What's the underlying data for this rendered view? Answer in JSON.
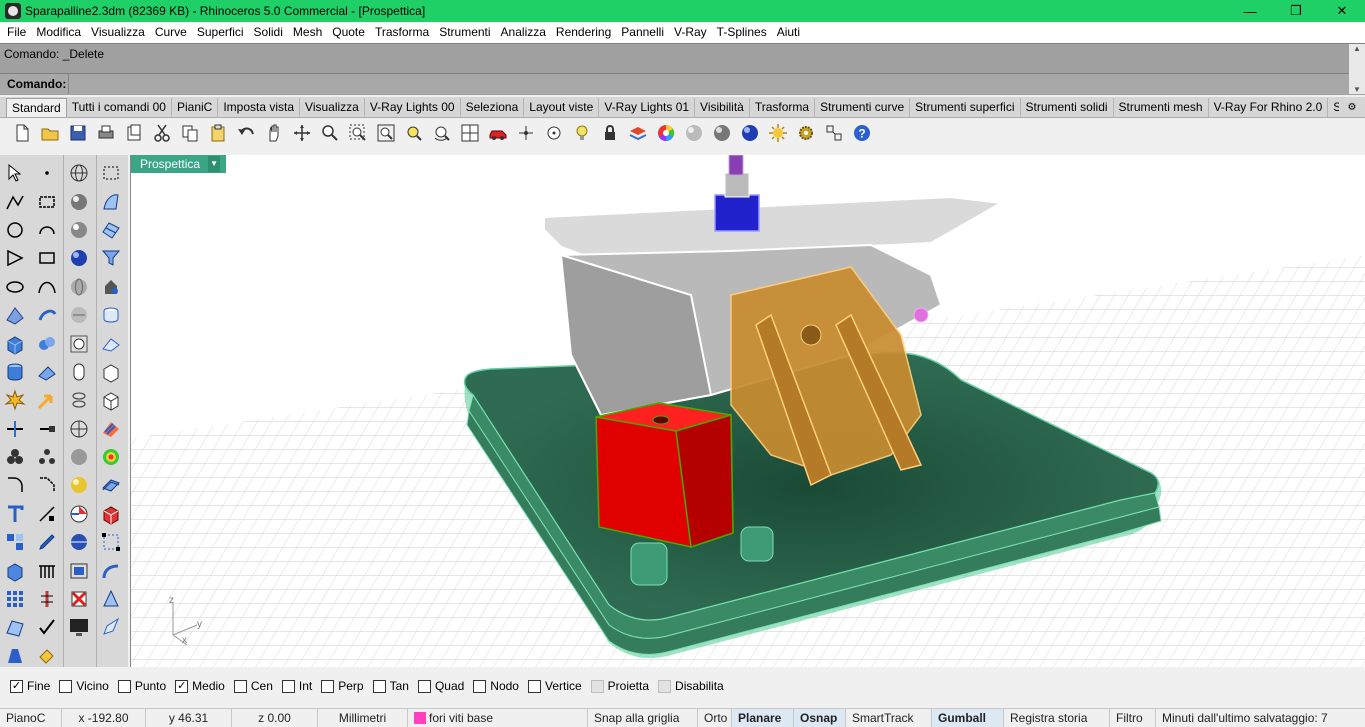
{
  "window": {
    "title": "Sparapalline2.3dm (82369 KB) - Rhinoceros 5.0 Commercial - [Prospettica]",
    "minimize": "—",
    "restore": "❐",
    "close": "✕"
  },
  "menu": [
    "File",
    "Modifica",
    "Visualizza",
    "Curve",
    "Superfici",
    "Solidi",
    "Mesh",
    "Quote",
    "Trasforma",
    "Strumenti",
    "Analizza",
    "Rendering",
    "Pannelli",
    "V-Ray",
    "T-Splines",
    "Aiuti"
  ],
  "command": {
    "history": "Comando: _Delete",
    "prompt_label": "Comando:",
    "input_value": ""
  },
  "tabs": [
    "Standard",
    "Tutti i comandi 00",
    "PianiC",
    "Imposta vista",
    "Visualizza",
    "V-Ray Lights 00",
    "Seleziona",
    "Layout viste",
    "V-Ray Lights 01",
    "Visibilità",
    "Trasforma",
    "Strumenti curve",
    "Strumenti superfici",
    "Strumenti solidi",
    "Strumenti mesh",
    "V-Ray For Rhino 2.0",
    "Stru"
  ],
  "toolbar_icons": [
    "new-file-icon",
    "open-folder-icon",
    "save-icon",
    "print-icon",
    "import-icon",
    "cut-icon",
    "copy-icon",
    "paste-icon",
    "undo-icon",
    "pan-hand-icon",
    "rotate-view-icon",
    "zoom-icon",
    "zoom-window-icon",
    "zoom-extents-icon",
    "zoom-selected-icon",
    "viewport-layout-icon",
    "car-icon",
    "point-icon",
    "target-icon",
    "light-bulb-icon",
    "lock-icon",
    "layer-icon",
    "color-wheel-icon",
    "sphere-icon",
    "sphere-dark-icon",
    "render-sphere-icon",
    "sun-icon",
    "gear-icon",
    "transform-icon",
    "help-icon"
  ],
  "viewport": {
    "tab_label": "Prospettica",
    "axis_x": "x",
    "axis_y": "y",
    "axis_z": "z",
    "colors": {
      "base_plate": "#2f6b52",
      "motor": "#e00000",
      "bracket": "#c98c30",
      "plate": "#d9d9d9",
      "gear": "#2222cc"
    }
  },
  "osnaps": [
    {
      "label": "Fine",
      "checked": true
    },
    {
      "label": "Vicino",
      "checked": false
    },
    {
      "label": "Punto",
      "checked": false
    },
    {
      "label": "Medio",
      "checked": true
    },
    {
      "label": "Cen",
      "checked": false
    },
    {
      "label": "Int",
      "checked": false
    },
    {
      "label": "Perp",
      "checked": false
    },
    {
      "label": "Tan",
      "checked": false
    },
    {
      "label": "Quad",
      "checked": false
    },
    {
      "label": "Nodo",
      "checked": false
    },
    {
      "label": "Vertice",
      "checked": false
    },
    {
      "label": "Proietta",
      "checked": false,
      "disabled": true
    },
    {
      "label": "Disabilita",
      "checked": false,
      "disabled": true
    }
  ],
  "status": {
    "cplane": "PianoC",
    "x": "x -192.80",
    "y": "y 46.31",
    "z": "z 0.00",
    "units": "Millimetri",
    "layer": "fori viti base",
    "layer_color": "#ff40c0",
    "grid_snap": "Snap alla griglia",
    "ortho": "Orto",
    "planar": "Planare",
    "osnap": "Osnap",
    "smarttrack": "SmartTrack",
    "gumball": "Gumball",
    "record_history": "Registra storia",
    "filter": "Filtro",
    "autosave": "Minuti dall'ultimo salvataggio: 7"
  }
}
